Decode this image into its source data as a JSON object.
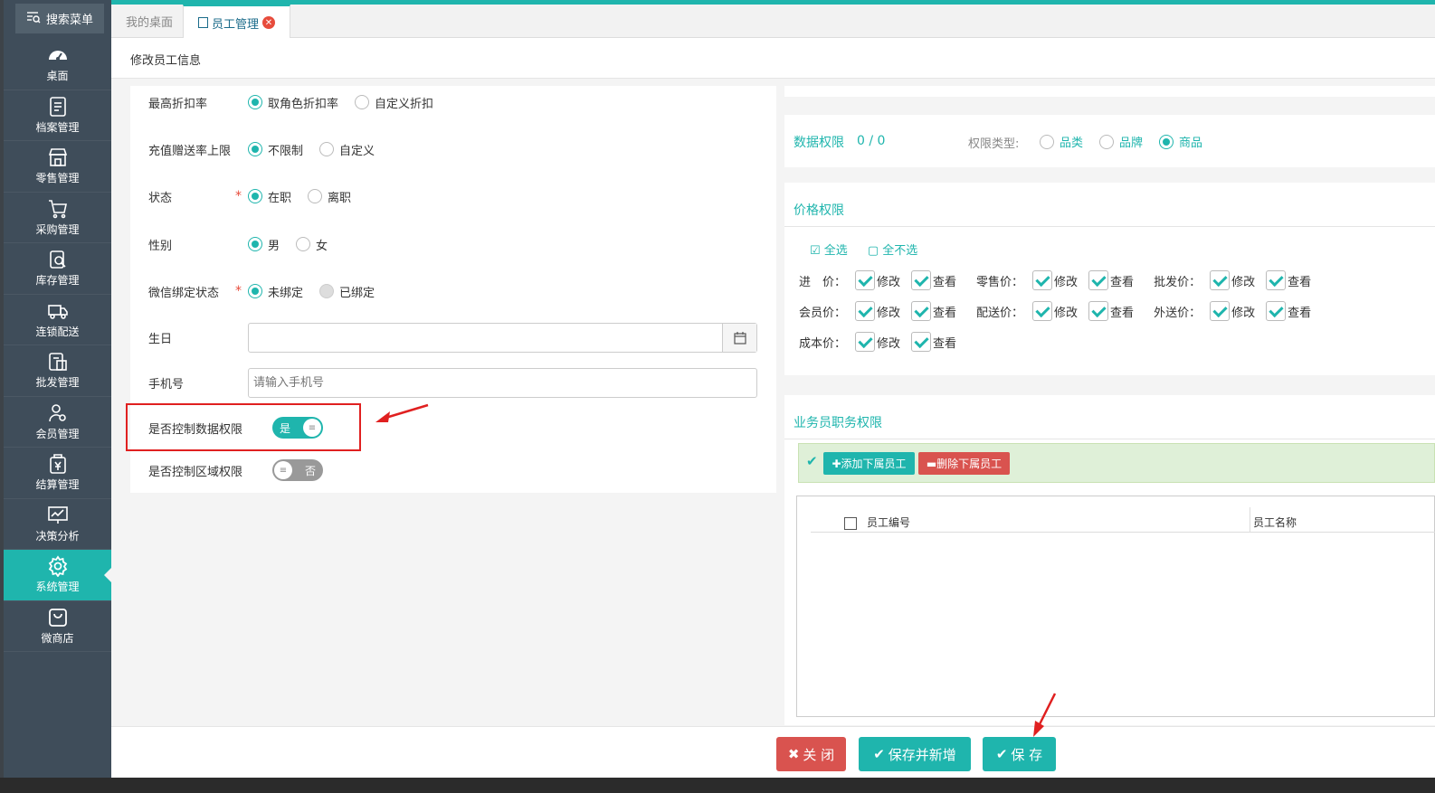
{
  "sidebar": {
    "search_label": "搜索菜单",
    "items": [
      {
        "label": "桌面",
        "icon": "dashboard-icon"
      },
      {
        "label": "档案管理",
        "icon": "file-icon"
      },
      {
        "label": "零售管理",
        "icon": "store-icon"
      },
      {
        "label": "采购管理",
        "icon": "cart-icon"
      },
      {
        "label": "库存管理",
        "icon": "inventory-icon"
      },
      {
        "label": "连锁配送",
        "icon": "truck-icon"
      },
      {
        "label": "批发管理",
        "icon": "wholesale-icon"
      },
      {
        "label": "会员管理",
        "icon": "member-icon"
      },
      {
        "label": "结算管理",
        "icon": "yen-icon"
      },
      {
        "label": "决策分析",
        "icon": "chart-icon"
      },
      {
        "label": "系统管理",
        "icon": "gear-icon",
        "active": true
      },
      {
        "label": "微商店",
        "icon": "bag-icon"
      }
    ]
  },
  "tabs": {
    "desktop": "我的桌面",
    "staff": "员工管理"
  },
  "page_title": "修改员工信息",
  "form": {
    "max_discount": {
      "label": "最高折扣率",
      "opt1": "取角色折扣率",
      "opt2": "自定义折扣"
    },
    "recharge": {
      "label": "充值赠送率上限",
      "opt1": "不限制",
      "opt2": "自定义"
    },
    "status": {
      "label": "状态",
      "req": "*",
      "opt1": "在职",
      "opt2": "离职"
    },
    "gender": {
      "label": "性别",
      "opt1": "男",
      "opt2": "女"
    },
    "wechat": {
      "label": "微信绑定状态",
      "req": "*",
      "opt1": "未绑定",
      "opt2": "已绑定"
    },
    "birthday": {
      "label": "生日"
    },
    "phone": {
      "label": "手机号",
      "placeholder": "请输入手机号"
    },
    "data_ctrl": {
      "label": "是否控制数据权限",
      "value": "是"
    },
    "area_ctrl": {
      "label": "是否控制区域权限",
      "value": "否"
    }
  },
  "data_perm": {
    "title": "数据权限",
    "count": "0 / 0",
    "type_label": "权限类型:",
    "opt1": "品类",
    "opt2": "品牌",
    "opt3": "商品"
  },
  "price_perm": {
    "title": "价格权限",
    "select_all": "全选",
    "deselect_all": "全不选",
    "edit": "修改",
    "view": "查看",
    "rows": [
      [
        "进　价：",
        "零售价：",
        "批发价："
      ],
      [
        "会员价：",
        "配送价：",
        "外送价："
      ],
      [
        "成本价："
      ]
    ]
  },
  "sales_perm": {
    "title": "业务员职务权限",
    "add_btn": "添加下属员工",
    "del_btn": "删除下属员工",
    "col1": "员工编号",
    "col2": "员工名称"
  },
  "buttons": {
    "close": "关 闭",
    "save_new": "保存并新增",
    "save": "保 存"
  },
  "colors": {
    "accent": "#1fb5ad",
    "danger": "#d9534f",
    "sidebar": "#3f4d5a"
  }
}
